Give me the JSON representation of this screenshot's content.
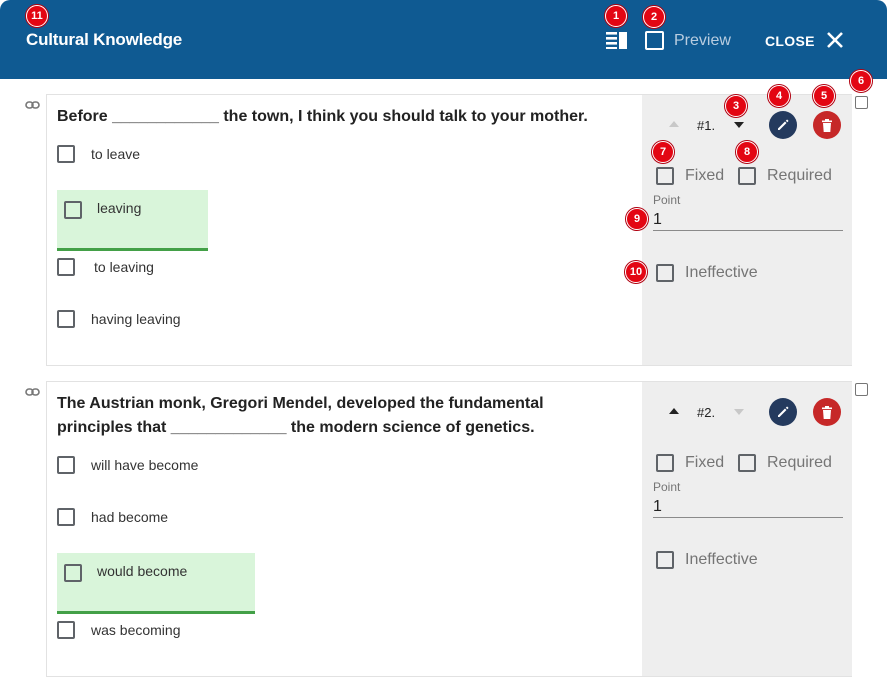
{
  "header": {
    "title": "Cultural Knowledge",
    "preview_label": "Preview",
    "close_label": "CLOSE",
    "bg_color": "#0f5a92"
  },
  "badges": [
    "1",
    "2",
    "3",
    "4",
    "5",
    "6",
    "7",
    "8",
    "9",
    "10",
    "11"
  ],
  "questions": [
    {
      "number": "#1.",
      "text": "Before ____________ the town, I think you should talk to your mother.",
      "options": [
        "to leave",
        "leaving",
        "to leaving",
        "having leaving"
      ],
      "correct_option": "leaving",
      "fixed_label": "Fixed",
      "required_label": "Required",
      "point_label": "Point",
      "point_value": "1",
      "ineffective_label": "Ineffective"
    },
    {
      "number": "#2.",
      "text": "The Austrian monk, Gregori Mendel, developed the fundamental principles that _____________ the modern science of genetics.",
      "options": [
        "will have become",
        "had become",
        "would become",
        "was becoming"
      ],
      "correct_option": "would become",
      "fixed_label": "Fixed",
      "required_label": "Required",
      "point_label": "Point",
      "point_value": "1",
      "ineffective_label": "Ineffective"
    }
  ],
  "icons": {
    "list": "list-view-icon",
    "close": "close-icon",
    "link": "link-icon",
    "edit": "pencil-icon",
    "delete": "trash-icon"
  },
  "colors": {
    "correct_bg": "#d9f5da",
    "correct_border": "#43a047",
    "edit_btn": "#243a5e",
    "delete_btn": "#c62828",
    "badge": "#e30613"
  }
}
